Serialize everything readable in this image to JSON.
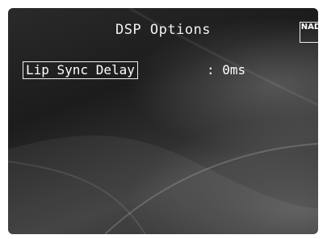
{
  "screen": {
    "title": "DSP Options",
    "brand_logo": "NAD"
  },
  "settings": [
    {
      "label": "Lip Sync Delay",
      "separator": ":",
      "value": "0ms",
      "selected": true
    }
  ],
  "colors": {
    "background": "#222222",
    "text": "#f2f2f2"
  }
}
